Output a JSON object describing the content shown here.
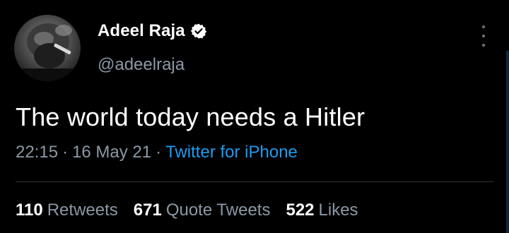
{
  "user": {
    "display_name": "Adeel Raja",
    "handle": "@adeelraja",
    "verified": true
  },
  "tweet": {
    "text": "The world today needs a Hitler",
    "time": "22:15",
    "date": "16 May 21",
    "separator": "·",
    "source": "Twitter for iPhone"
  },
  "stats": {
    "retweets": {
      "count": "110",
      "label": "Retweets"
    },
    "quote_tweets": {
      "count": "671",
      "label": "Quote Tweets"
    },
    "likes": {
      "count": "522",
      "label": "Likes"
    }
  },
  "icons": {
    "verified": "verified-badge-icon",
    "more": "more-vertical-icon"
  },
  "colors": {
    "background": "#000000",
    "text": "#ffffff",
    "muted": "#8b98a5",
    "link": "#1d9bf0",
    "divider": "#2f3336"
  }
}
